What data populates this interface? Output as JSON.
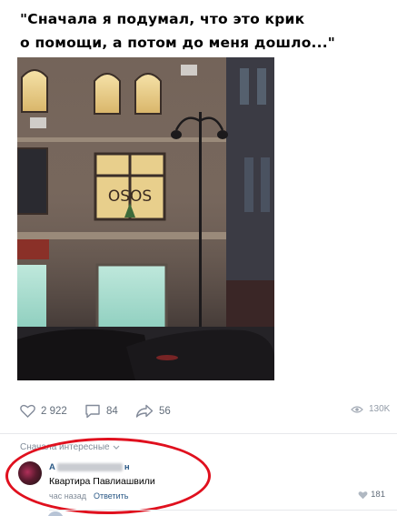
{
  "post": {
    "caption_line1": "\"Сначала я подумал, что это крик",
    "caption_line2": "о помощи, а потом до меня дошло...\"",
    "window_text": "OSOS"
  },
  "actions": {
    "likes": "2 922",
    "comments": "84",
    "shares": "56",
    "views": "130K"
  },
  "comments": {
    "sort_label": "Сначала интересные",
    "items": [
      {
        "author_start": "А",
        "author_end": "н",
        "text": "Квартира Павлиашвили",
        "time": "час назад",
        "reply_label": "Ответить",
        "likes": "181"
      }
    ]
  },
  "colors": {
    "link": "#2a5885",
    "muted": "#818c99",
    "highlight": "#e0101e"
  }
}
